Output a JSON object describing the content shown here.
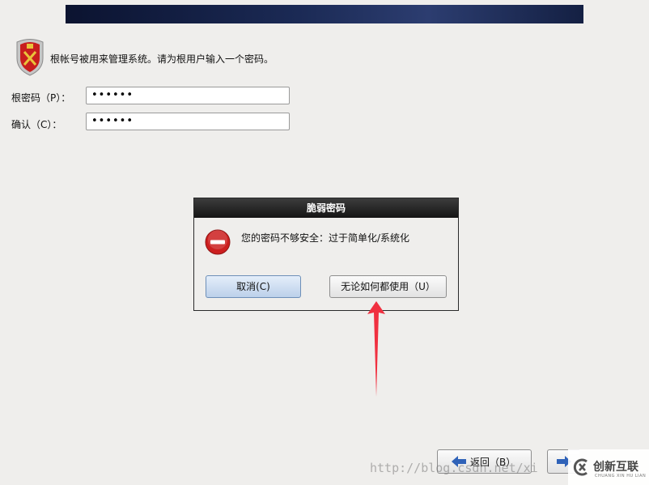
{
  "intro_text": "根帐号被用来管理系统。请为根用户输入一个密码。",
  "form": {
    "password_label": "根密码（P）：",
    "password_value": "••••••",
    "confirm_label": "确认（C）：",
    "confirm_value": "••••••"
  },
  "dialog": {
    "title": "脆弱密码",
    "message": "您的密码不够安全：过于简单化/系统化",
    "cancel_label": "取消(C)",
    "use_anyway_label": "无论如何都使用（U）"
  },
  "nav": {
    "back_label": "返回（B）"
  },
  "watermark": {
    "url_text": "http://blog.csdn.net/xi",
    "brand_name": "创新互联",
    "brand_sub": "CHUANG XIN HU LIAN"
  },
  "colors": {
    "banner": "#1b2a55",
    "error_red": "#cc1f1f",
    "annotation_arrow": "#f03040",
    "nav_arrow": "#2f62b8"
  },
  "icons": {
    "shield": "shield-icon",
    "error": "error-icon",
    "back": "back-arrow-icon",
    "next": "next-arrow-icon"
  }
}
